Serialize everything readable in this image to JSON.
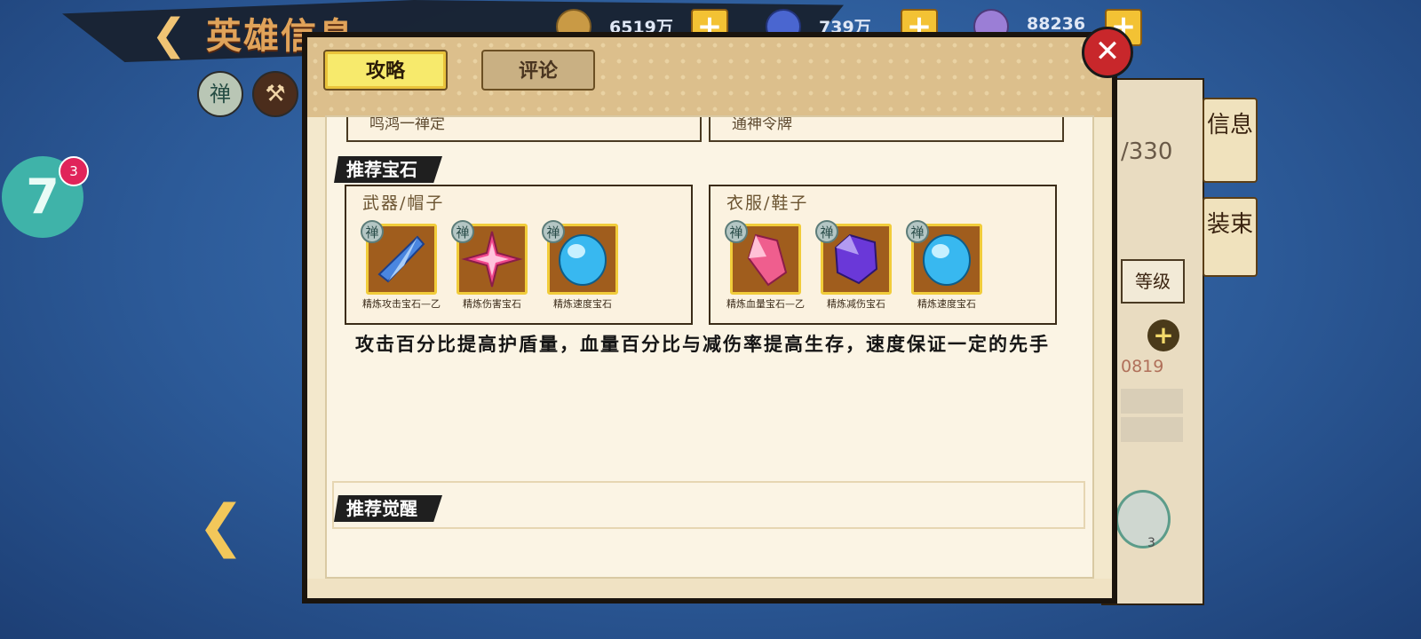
{
  "background": {
    "title": "英雄信息",
    "currencies": [
      {
        "icon": "coin-icon",
        "value": "6519万"
      },
      {
        "icon": "flame-icon",
        "value": "739万"
      },
      {
        "icon": "gem-icon",
        "value": "88236"
      }
    ],
    "round_icons": {
      "zen": "禅"
    },
    "badge": {
      "count": "3",
      "label": "7"
    },
    "right_panel": {
      "count_text": "/330",
      "tab_info": "信息",
      "tab_equip": "装束",
      "level_label": "等级",
      "number_text": "0819",
      "shield_count": "3"
    }
  },
  "dialog": {
    "tabs": [
      {
        "label": "攻略",
        "active": true
      },
      {
        "label": "评论",
        "active": false
      }
    ],
    "cut_items": [
      {
        "text": "鸣鸿一禅定"
      },
      {
        "text": "通神令牌"
      }
    ],
    "section_gems": {
      "title": "推荐宝石",
      "panels": [
        {
          "title": "武器/帽子",
          "gems": [
            {
              "badge": "禅",
              "icon": "blue-crystal-icon",
              "label": "精炼攻击宝石—乙",
              "color": "#3e7bd8"
            },
            {
              "badge": "禅",
              "icon": "pink-star-gem-icon",
              "label": "精炼伤害宝石",
              "color": "#f0478c"
            },
            {
              "badge": "禅",
              "icon": "cyan-orb-gem-icon",
              "label": "精炼速度宝石",
              "color": "#38b8f0"
            }
          ]
        },
        {
          "title": "衣服/鞋子",
          "gems": [
            {
              "badge": "禅",
              "icon": "pink-crystal-icon",
              "label": "精炼血量宝石—乙",
              "color": "#ef5e8e"
            },
            {
              "badge": "禅",
              "icon": "purple-gem-icon",
              "label": "精炼减伤宝石",
              "color": "#6a38d8"
            },
            {
              "badge": "禅",
              "icon": "cyan-orb-gem-icon",
              "label": "精炼速度宝石",
              "color": "#38b8f0"
            }
          ]
        }
      ],
      "description": "攻击百分比提高护盾量，血量百分比与减伤率提高生存，速度保证一定的先手"
    },
    "section_awaken": {
      "title": "推荐觉醒"
    },
    "close_icon": "close-icon"
  }
}
